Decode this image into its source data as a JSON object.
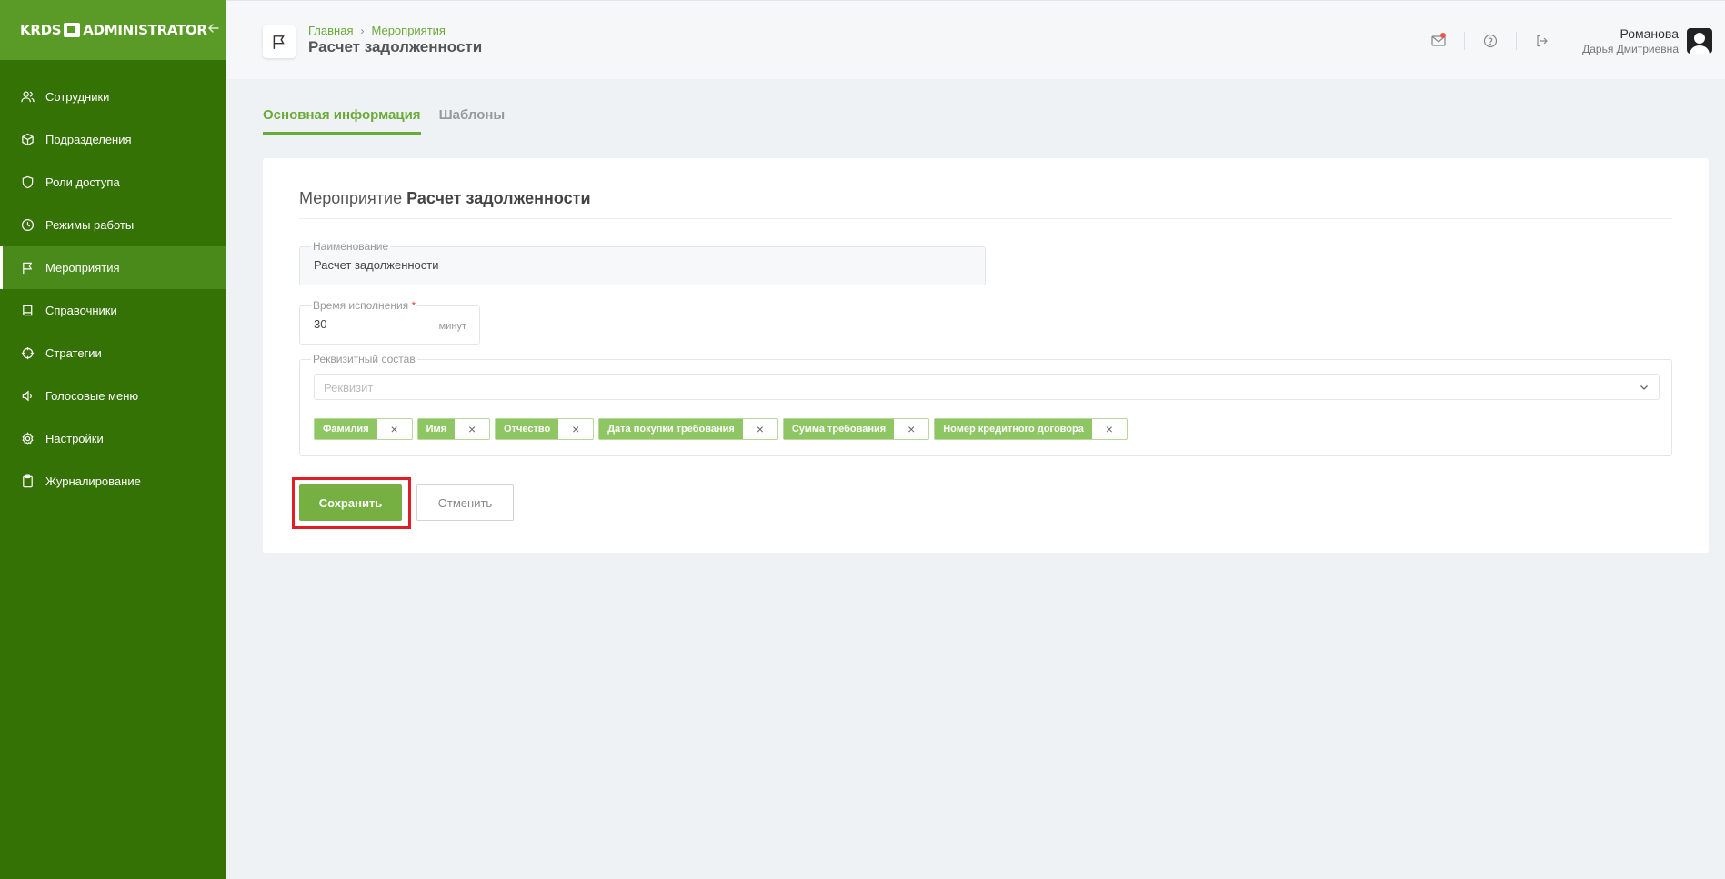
{
  "app": {
    "logo_left": "KRDS",
    "logo_right": "ADMINISTRATOR"
  },
  "sidebar": {
    "items": [
      {
        "label": "Сотрудники",
        "icon": "users-icon"
      },
      {
        "label": "Подразделения",
        "icon": "cube-icon"
      },
      {
        "label": "Роли доступа",
        "icon": "shield-icon"
      },
      {
        "label": "Режимы работы",
        "icon": "clock-icon"
      },
      {
        "label": "Мероприятия",
        "icon": "flag-icon",
        "active": true
      },
      {
        "label": "Справочники",
        "icon": "book-icon"
      },
      {
        "label": "Стратегии",
        "icon": "target-icon"
      },
      {
        "label": "Голосовые меню",
        "icon": "speaker-icon"
      },
      {
        "label": "Настройки",
        "icon": "gear-icon"
      },
      {
        "label": "Журналирование",
        "icon": "clipboard-icon"
      }
    ]
  },
  "header": {
    "breadcrumb": [
      "Главная",
      "Мероприятия"
    ],
    "title": "Расчет задолженности",
    "user_last_name": "Романова",
    "user_first_names": "Дарья Дмитриевна"
  },
  "tabs": [
    "Основная информация",
    "Шаблоны"
  ],
  "form": {
    "title_prefix": "Мероприятие",
    "title_name": "Расчет задолженности",
    "name_label": "Наименование",
    "name_value": "Расчет задолженности",
    "time_label": "Время исполнения",
    "time_required": "*",
    "time_value": "30",
    "time_unit": "минут",
    "req_label": "Реквизитный состав",
    "req_placeholder": "Реквизит",
    "chips": [
      "Фамилия",
      "Имя",
      "Отчество",
      "Дата покупки требования",
      "Сумма требования",
      "Номер кредитного договора"
    ],
    "save_label": "Сохранить",
    "cancel_label": "Отменить"
  },
  "colors": {
    "sidebar": "#357206",
    "accent": "#76b043",
    "highlight": "#e11d2a"
  }
}
